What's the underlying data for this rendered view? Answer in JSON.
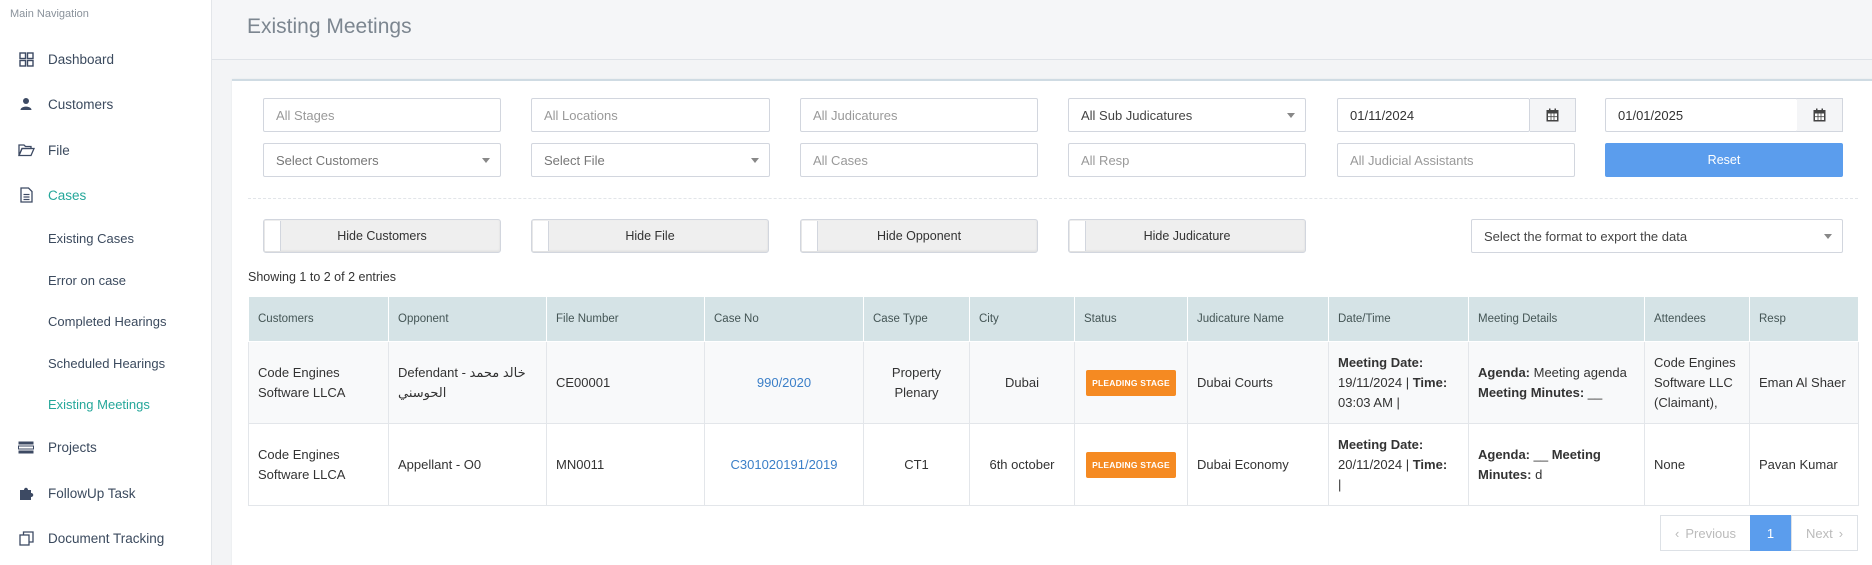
{
  "sidebar": {
    "heading": "Main Navigation",
    "items": [
      {
        "label": "Dashboard",
        "icon": "dashboard-grid-icon"
      },
      {
        "label": "Customers",
        "icon": "user-icon"
      },
      {
        "label": "File",
        "icon": "folder-open-icon"
      },
      {
        "label": "Cases",
        "icon": "document-icon"
      },
      {
        "label": "Projects",
        "icon": "list-icon"
      },
      {
        "label": "FollowUp Task",
        "icon": "puzzle-icon"
      },
      {
        "label": "Document Tracking",
        "icon": "copy-icon"
      }
    ],
    "sub_items": [
      "Existing Cases",
      "Error on case",
      "Completed Hearings",
      "Scheduled Hearings",
      "Existing Meetings"
    ]
  },
  "page": {
    "title": "Existing Meetings"
  },
  "filters": {
    "stages": "All Stages",
    "locations": "All Locations",
    "judicatures": "All Judicatures",
    "sub_judicatures": "All Sub Judicatures",
    "date_from": "01/11/2024",
    "date_to": "01/01/2025",
    "customers": "Select Customers",
    "file": "Select File",
    "cases": "All Cases",
    "resp": "All Resp",
    "judicial_assistants": "All Judicial Assistants",
    "reset": "Reset"
  },
  "toggles": {
    "hide_customers": "Hide Customers",
    "hide_file": "Hide File",
    "hide_opponent": "Hide Opponent",
    "hide_judicature": "Hide Judicature"
  },
  "export": {
    "placeholder": "Select the format to export the data"
  },
  "showing": "Showing 1 to 2 of 2 entries",
  "table": {
    "headers": [
      "Customers",
      "Opponent",
      "File Number",
      "Case No",
      "Case Type",
      "City",
      "Status",
      "Judicature Name",
      "Date/Time",
      "Meeting Details",
      "Attendees",
      "Resp"
    ],
    "rows": [
      {
        "customer": "Code Engines Software LLCA",
        "opponent": "Defendant - خالد محمد الحوسني",
        "file_number": "CE00001",
        "case_no": "990/2020",
        "case_type": "Property Plenary",
        "city": "Dubai",
        "status": "PLEADING STAGE",
        "judicature": "Dubai Courts",
        "meeting_date_label": "Meeting Date:",
        "meeting_date": "19/11/2024 |",
        "time_label": "Time:",
        "time": "03:03 AM |",
        "agenda_label": "Agenda:",
        "agenda": "Meeting agenda",
        "minutes_label": "Meeting Minutes:",
        "minutes": "__",
        "attendees": "Code Engines Software LLC (Claimant),",
        "resp": "Eman Al Shaer"
      },
      {
        "customer": "Code Engines Software LLCA",
        "opponent": "Appellant - O0",
        "file_number": "MN0011",
        "case_no": "C301020191/2019",
        "case_type": "CT1",
        "city": "6th october",
        "status": "PLEADING STAGE",
        "judicature": "Dubai Economy",
        "meeting_date_label": "Meeting Date:",
        "meeting_date": "20/11/2024 |",
        "time_label": "Time:",
        "time": "|",
        "agenda_label": "Agenda:",
        "agenda": "__",
        "minutes_label": "Meeting Minutes:",
        "minutes": "d",
        "attendees": "None",
        "resp": "Pavan Kumar"
      }
    ]
  },
  "pagination": {
    "previous": "Previous",
    "page": "1",
    "next": "Next"
  },
  "colors": {
    "accent": "#25a79a",
    "primary": "#5b9ded",
    "status_badge": "#f58a22",
    "link": "#3b7fc8"
  }
}
